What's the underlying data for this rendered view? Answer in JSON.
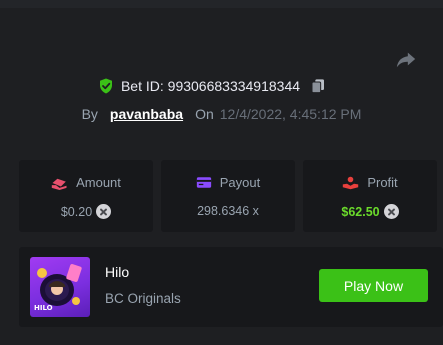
{
  "bet": {
    "id_text": "Bet ID: 99306683334918344",
    "by_label": "By",
    "username": "pavanbaba",
    "on_label": "On",
    "datetime": "12/4/2022, 4:45:12 PM"
  },
  "stats": {
    "amount": {
      "label": "Amount",
      "value": "$0.20",
      "icon": "money-hand-icon",
      "color": "#e8506d"
    },
    "payout": {
      "label": "Payout",
      "value": "298.6346 x",
      "icon": "card-icon",
      "color": "#8a4bff"
    },
    "profit": {
      "label": "Profit",
      "value": "$62.50",
      "icon": "hand-coin-icon",
      "color": "#e8403d"
    }
  },
  "game": {
    "title": "Hilo",
    "subtitle": "BC Originals",
    "thumb_label": "HILO",
    "play_label": "Play Now"
  },
  "colors": {
    "accent_green": "#3bc117",
    "profit_green": "#6bdb2b",
    "shield_green": "#3bc117"
  }
}
